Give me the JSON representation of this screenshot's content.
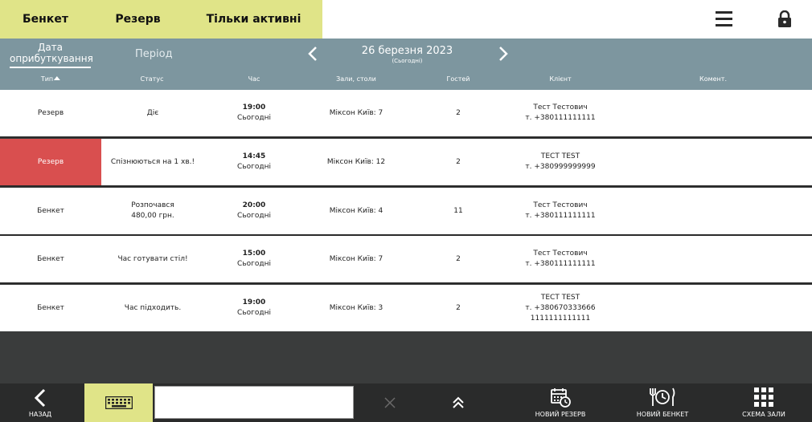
{
  "filters": [
    "Бенкет",
    "Резерв",
    "Тільки активні"
  ],
  "header_icons": {
    "menu": "menu-icon",
    "lock": "lock-icon"
  },
  "date_nav": {
    "tab_date": "Дата оприбуткування",
    "tab_period": "Період",
    "date": "26 березня 2023",
    "date_sub": "(Сьогодні)"
  },
  "columns": {
    "type": "Тип",
    "status": "Статус",
    "time": "Час",
    "halls": "Зали, столи",
    "guests": "Гостей",
    "client": "Клієнт",
    "comment": "Комент."
  },
  "rows": [
    {
      "type": "Резерв",
      "late": false,
      "status": [
        "Діє"
      ],
      "time": "19:00",
      "day": "Сьогодні",
      "halls": "Міксон Київ: 7",
      "guests": "2",
      "client": [
        "Тест Тестович",
        "т. +380111111111"
      ]
    },
    {
      "type": "Резерв",
      "late": true,
      "status": [
        "Спізнюються на 1 хв.!"
      ],
      "time": "14:45",
      "day": "Сьогодні",
      "halls": "Міксон Київ: 12",
      "guests": "2",
      "client": [
        "TECT TEST",
        "т. +380999999999"
      ]
    },
    {
      "type": "Бенкет",
      "late": false,
      "status": [
        "Розпочався",
        "480,00 грн."
      ],
      "time": "20:00",
      "day": "Сьогодні",
      "halls": "Міксон Київ: 4",
      "guests": "11",
      "client": [
        "Тест Тестович",
        "т. +380111111111"
      ]
    },
    {
      "type": "Бенкет",
      "late": false,
      "status": [
        "Час готувати стіл!"
      ],
      "time": "15:00",
      "day": "Сьогодні",
      "halls": "Міксон Київ: 7",
      "guests": "2",
      "client": [
        "Тест Тестович",
        "т. +380111111111"
      ]
    },
    {
      "type": "Бенкет",
      "late": false,
      "status": [
        "Час підходить."
      ],
      "time": "19:00",
      "day": "Сьогодні",
      "halls": "Міксон Київ: 3",
      "guests": "2",
      "client": [
        "TECT TEST",
        "т. +380670333666",
        "1111111111111"
      ]
    }
  ],
  "colors": {
    "accent": "#e0e488",
    "header": "#7d969f",
    "late": "#d94f4f",
    "bottom": "#2a2b2b"
  },
  "bottom": {
    "back": "НАЗАД",
    "search_value": "",
    "new_reserve": "НОВИЙ РЕЗЕРВ",
    "new_banquet": "НОВИЙ БЕНКЕТ",
    "hall_scheme": "СХЕМА ЗАЛИ"
  }
}
